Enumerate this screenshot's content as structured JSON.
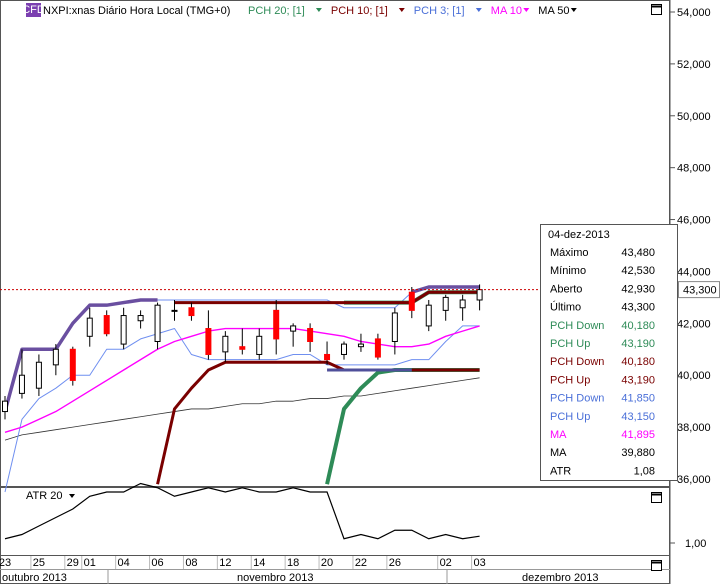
{
  "header": {
    "cfd_badge": "CFD",
    "symbol": "NXPI:xnas Diário Hora Local (TMG+0)",
    "indicators": [
      {
        "label": "PCH 20; [1]",
        "color": "#2e8b57"
      },
      {
        "label": "PCH 10; [1]",
        "color": "#7a0000"
      },
      {
        "label": "PCH 3; [1]",
        "color": "#4a6fd8"
      },
      {
        "label": "MA 10",
        "color": "#ff00ff"
      },
      {
        "label": "MA 50",
        "color": "#000000"
      }
    ]
  },
  "atr_panel": {
    "label": "ATR 20",
    "value_label": "1,00"
  },
  "price_tag": "43,300",
  "data_window": {
    "date": "04-dez-2013",
    "rows": [
      {
        "label": "Máximo",
        "value": "43,480",
        "color": "#000000"
      },
      {
        "label": "Mínimo",
        "value": "42,530",
        "color": "#000000"
      },
      {
        "label": "Aberto",
        "value": "42,930",
        "color": "#000000"
      },
      {
        "label": "Último",
        "value": "43,300",
        "color": "#000000"
      },
      {
        "label": "PCH Down",
        "value": "40,180",
        "color": "#2e8b57"
      },
      {
        "label": "PCH Up",
        "value": "43,190",
        "color": "#2e8b57"
      },
      {
        "label": "PCH Down",
        "value": "40,180",
        "color": "#7a0000"
      },
      {
        "label": "PCH Up",
        "value": "43,190",
        "color": "#7a0000"
      },
      {
        "label": "PCH Down",
        "value": "41,850",
        "color": "#4a6fd8"
      },
      {
        "label": "PCH Up",
        "value": "43,150",
        "color": "#4a6fd8"
      },
      {
        "label": "MA",
        "value": "41,895",
        "color": "#ff00ff"
      },
      {
        "label": "MA",
        "value": "39,880",
        "color": "#000000"
      },
      {
        "label": "ATR",
        "value": "1,08",
        "color": "#000000"
      }
    ]
  },
  "chart_data": {
    "type": "candlestick",
    "y_ticks": [
      "54,000",
      "52,000",
      "50,000",
      "48,000",
      "46,000",
      "44,000",
      "42,000",
      "40,000",
      "38,000",
      "36,000"
    ],
    "ylim": [
      35.5,
      54.3
    ],
    "last_price": 43.3,
    "x_day_ticks": [
      "23",
      "25",
      "29",
      "01",
      "04",
      "06",
      "08",
      "12",
      "14",
      "18",
      "20",
      "22",
      "26",
      "02",
      "03"
    ],
    "months": [
      "outubro 2013",
      "novembro 2013",
      "dezembro 2013"
    ],
    "candles": [
      {
        "o": 38.6,
        "h": 39.2,
        "l": 38.3,
        "c": 39.0
      },
      {
        "o": 39.3,
        "h": 41.0,
        "l": 39.1,
        "c": 40.0
      },
      {
        "o": 39.5,
        "h": 40.8,
        "l": 39.2,
        "c": 40.5
      },
      {
        "o": 40.4,
        "h": 41.2,
        "l": 40.0,
        "c": 41.0
      },
      {
        "o": 41.0,
        "h": 41.1,
        "l": 39.6,
        "c": 39.8
      },
      {
        "o": 41.5,
        "h": 42.6,
        "l": 41.1,
        "c": 42.2
      },
      {
        "o": 42.3,
        "h": 42.5,
        "l": 41.5,
        "c": 41.6
      },
      {
        "o": 41.2,
        "h": 42.6,
        "l": 41.0,
        "c": 42.3
      },
      {
        "o": 42.1,
        "h": 42.5,
        "l": 41.8,
        "c": 42.3
      },
      {
        "o": 41.3,
        "h": 42.8,
        "l": 41.0,
        "c": 42.7
      },
      {
        "o": 42.5,
        "h": 42.9,
        "l": 42.1,
        "c": 42.5
      },
      {
        "o": 42.6,
        "h": 42.8,
        "l": 42.1,
        "c": 42.3
      },
      {
        "o": 41.8,
        "h": 42.5,
        "l": 40.6,
        "c": 40.8
      },
      {
        "o": 40.9,
        "h": 41.7,
        "l": 40.5,
        "c": 41.5
      },
      {
        "o": 41.1,
        "h": 41.8,
        "l": 40.8,
        "c": 41.0
      },
      {
        "o": 40.8,
        "h": 41.8,
        "l": 40.6,
        "c": 41.5
      },
      {
        "o": 42.5,
        "h": 42.9,
        "l": 40.8,
        "c": 41.4
      },
      {
        "o": 41.7,
        "h": 42.0,
        "l": 41.1,
        "c": 41.9
      },
      {
        "o": 41.8,
        "h": 42.0,
        "l": 40.9,
        "c": 41.3
      },
      {
        "o": 40.8,
        "h": 41.3,
        "l": 40.4,
        "c": 40.6
      },
      {
        "o": 40.8,
        "h": 41.3,
        "l": 40.6,
        "c": 41.2
      },
      {
        "o": 41.1,
        "h": 41.6,
        "l": 40.9,
        "c": 41.2
      },
      {
        "o": 41.4,
        "h": 41.6,
        "l": 40.6,
        "c": 40.7
      },
      {
        "o": 41.3,
        "h": 42.6,
        "l": 40.8,
        "c": 42.4
      },
      {
        "o": 43.2,
        "h": 43.4,
        "l": 42.2,
        "c": 42.5
      },
      {
        "o": 41.9,
        "h": 42.9,
        "l": 41.7,
        "c": 42.7
      },
      {
        "o": 42.5,
        "h": 43.1,
        "l": 42.1,
        "c": 43.0
      },
      {
        "o": 42.6,
        "h": 43.1,
        "l": 42.1,
        "c": 42.9
      },
      {
        "o": 42.9,
        "h": 43.5,
        "l": 42.5,
        "c": 43.3
      }
    ],
    "pch20_up": [
      null,
      null,
      null,
      null,
      null,
      null,
      null,
      null,
      null,
      null,
      null,
      null,
      null,
      null,
      null,
      null,
      null,
      null,
      null,
      null,
      42.8,
      42.8,
      42.8,
      42.8,
      42.8,
      43.2,
      43.2,
      43.2,
      43.2
    ],
    "pch20_down": [
      null,
      null,
      null,
      null,
      null,
      null,
      null,
      null,
      null,
      null,
      null,
      null,
      null,
      null,
      null,
      null,
      null,
      null,
      null,
      35.8,
      38.7,
      39.5,
      40.1,
      40.2,
      40.2,
      40.2,
      40.2,
      40.2,
      40.2
    ],
    "pch10_up": [
      null,
      null,
      null,
      null,
      null,
      null,
      null,
      null,
      null,
      null,
      42.8,
      42.8,
      42.8,
      42.8,
      42.8,
      42.8,
      42.8,
      42.8,
      42.8,
      42.8,
      42.8,
      42.8,
      42.8,
      42.8,
      42.8,
      43.2,
      43.2,
      43.2,
      43.2
    ],
    "pch10_down": [
      null,
      null,
      null,
      null,
      null,
      null,
      null,
      null,
      null,
      35.8,
      38.7,
      39.5,
      40.2,
      40.5,
      40.5,
      40.5,
      40.5,
      40.5,
      40.5,
      40.5,
      40.2,
      40.2,
      40.2,
      40.2,
      40.2,
      40.2,
      40.2,
      40.2,
      40.2
    ],
    "pch3_up": [
      38.6,
      41.0,
      41.0,
      41.0,
      42.0,
      42.7,
      42.7,
      42.8,
      42.9,
      42.9,
      42.9,
      42.9,
      42.9,
      42.9,
      42.9,
      42.9,
      42.9,
      42.9,
      42.9,
      42.9,
      42.6,
      42.6,
      42.6,
      42.6,
      43.2,
      43.4,
      43.4,
      43.4,
      43.4
    ],
    "pch3_down": [
      35.5,
      38.3,
      39.1,
      39.5,
      40.0,
      40.0,
      41.0,
      41.0,
      41.4,
      41.6,
      41.8,
      40.8,
      40.6,
      40.6,
      40.6,
      40.6,
      40.6,
      40.8,
      40.8,
      40.4,
      40.4,
      40.4,
      40.4,
      40.4,
      40.6,
      40.6,
      41.3,
      41.9,
      41.9
    ],
    "ma10": [
      37.8,
      38.0,
      38.3,
      38.6,
      39.0,
      39.4,
      39.8,
      40.2,
      40.6,
      41.0,
      41.3,
      41.5,
      41.7,
      41.8,
      41.8,
      41.8,
      41.8,
      41.8,
      41.7,
      41.6,
      41.5,
      41.3,
      41.2,
      41.1,
      41.1,
      41.2,
      41.5,
      41.7,
      41.9
    ],
    "ma50": [
      37.5,
      37.7,
      37.8,
      37.9,
      38.0,
      38.1,
      38.2,
      38.3,
      38.4,
      38.5,
      38.6,
      38.7,
      38.7,
      38.8,
      38.9,
      38.9,
      39.0,
      39.0,
      39.1,
      39.1,
      39.2,
      39.2,
      39.3,
      39.4,
      39.5,
      39.6,
      39.7,
      39.8,
      39.9
    ],
    "atr": [
      1.05,
      1.1,
      1.2,
      1.3,
      1.4,
      1.55,
      1.6,
      1.6,
      1.7,
      1.65,
      1.55,
      1.6,
      1.65,
      1.6,
      1.65,
      1.6,
      1.6,
      1.65,
      1.6,
      1.6,
      1.05,
      1.1,
      1.05,
      1.15,
      1.15,
      1.05,
      1.1,
      1.05,
      1.08
    ]
  }
}
